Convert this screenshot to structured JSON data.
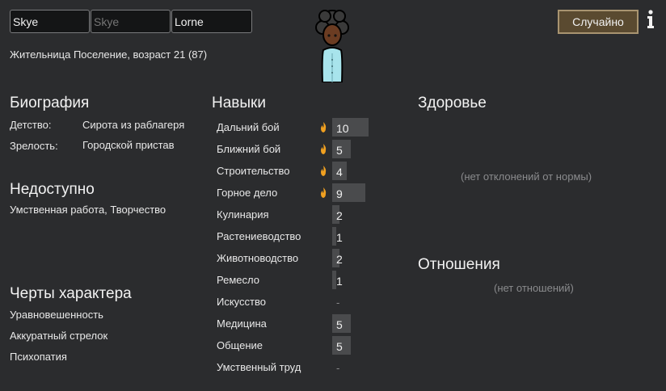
{
  "name": {
    "first": "Skye",
    "nick_placeholder": "Skye",
    "last": "Lorne"
  },
  "random_button": "Случайно",
  "info_icon": "info-icon",
  "description": "Жительница Поселение, возраст 21 (87)",
  "backstory": {
    "title": "Биография",
    "childhood_label": "Детство:",
    "childhood_value": "Сирота из раблагеря",
    "adulthood_label": "Зрелость:",
    "adulthood_value": "Городской пристав"
  },
  "incapable": {
    "title": "Недоступно",
    "value": "Умственная работа, Творчество"
  },
  "traits": {
    "title": "Черты характера",
    "items": [
      "Уравновешенность",
      "Аккуратный стрелок",
      "Психопатия"
    ]
  },
  "skills": {
    "title": "Навыки",
    "items": [
      {
        "name": "Дальний бой",
        "level": "10",
        "passion": true
      },
      {
        "name": "Ближний бой",
        "level": "5",
        "passion": true
      },
      {
        "name": "Строительство",
        "level": "4",
        "passion": true
      },
      {
        "name": "Горное дело",
        "level": "9",
        "passion": true
      },
      {
        "name": "Кулинария",
        "level": "2",
        "passion": false
      },
      {
        "name": "Растениеводство",
        "level": "1",
        "passion": false
      },
      {
        "name": "Животноводство",
        "level": "2",
        "passion": false
      },
      {
        "name": "Ремесло",
        "level": "1",
        "passion": false
      },
      {
        "name": "Искусство",
        "level": "-",
        "passion": false
      },
      {
        "name": "Медицина",
        "level": "5",
        "passion": false
      },
      {
        "name": "Общение",
        "level": "5",
        "passion": false
      },
      {
        "name": "Умственный труд",
        "level": "-",
        "passion": false
      }
    ]
  },
  "health": {
    "title": "Здоровье",
    "empty": "(нет отклонений от нормы)"
  },
  "relations": {
    "title": "Отношения",
    "empty": "(нет отношений)"
  },
  "colors": {
    "background": "#2b2c2e",
    "passion_flame": "#f0a020",
    "button": "#5a4a30"
  }
}
